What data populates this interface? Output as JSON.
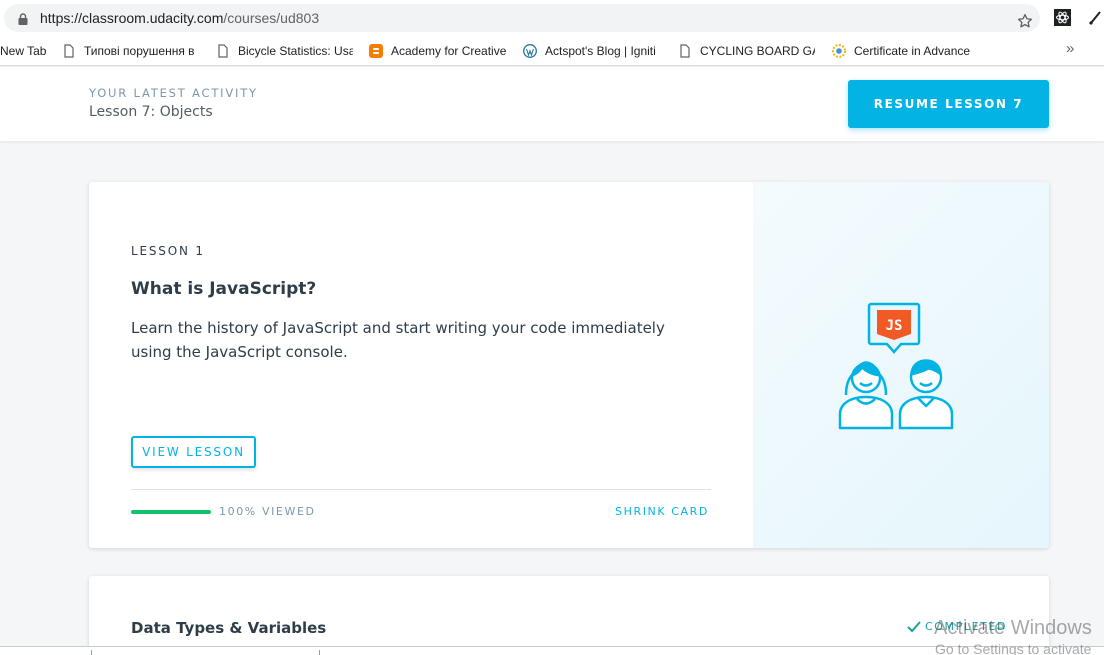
{
  "browser": {
    "url_host": "https://classroom.udacity.com",
    "url_path": "/courses/ud803",
    "icons": [
      "lock-icon",
      "star-icon",
      "extension-icon"
    ]
  },
  "bookmarks": {
    "items": [
      {
        "label": "New Tab",
        "icon": "none"
      },
      {
        "label": "Типові порушення в",
        "icon": "page-icon"
      },
      {
        "label": "Bicycle Statistics: Usa",
        "icon": "page-icon"
      },
      {
        "label": "Academy for Creative",
        "icon": "blogger-icon"
      },
      {
        "label": "Actspot's Blog | Igniti",
        "icon": "wordpress-icon"
      },
      {
        "label": "CYCLING BOARD GAI",
        "icon": "page-icon"
      },
      {
        "label": "Certificate in Advance",
        "icon": "sunflower-icon"
      }
    ],
    "more": "»"
  },
  "activity": {
    "label": "YOUR LATEST ACTIVITY",
    "lesson": "Lesson 7: Objects",
    "resume_label": "RESUME LESSON 7"
  },
  "lesson_card": {
    "kicker": "LESSON 1",
    "title": "What is JavaScript?",
    "description": "Learn the history of JavaScript and start writing your code immediately using the JavaScript console.",
    "view_label": "VIEW LESSON",
    "progress_percent": 100,
    "progress_label": "100% VIEWED",
    "shrink_label": "SHRINK CARD",
    "badge_text": "JS",
    "colors": {
      "accent": "#02b3e4",
      "progress": "#15c26b",
      "badge": "#f15a24"
    }
  },
  "next_card": {
    "title": "Data Types & Variables",
    "status": "COMPLETED"
  },
  "watermark": {
    "line1": "Activate Windows",
    "line2": "Go to Settings to activate"
  }
}
